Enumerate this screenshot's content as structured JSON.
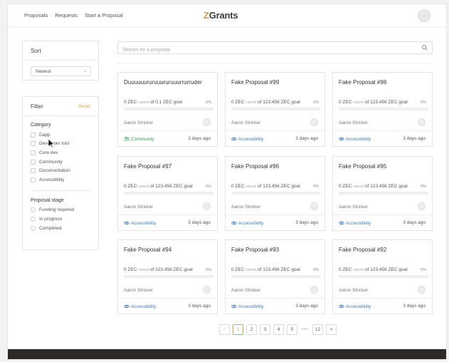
{
  "nav": {
    "links": [
      "Proposals",
      "Requests",
      "Start a Proposal"
    ]
  },
  "brand": {
    "prefix": "Z",
    "name": "Grants",
    "accent": "#c8a052"
  },
  "sort": {
    "heading": "Sort",
    "selected": "Newest"
  },
  "filter": {
    "heading": "Filter",
    "reset": "Reset",
    "category_title": "Category",
    "categories": [
      "Dapp",
      "Developer tool",
      "Core dev",
      "Community",
      "Documentation",
      "Accessibility"
    ],
    "stage_title": "Proposal stage",
    "stages": [
      "Funding required",
      "In progress",
      "Completed"
    ]
  },
  "search": {
    "placeholder": "Search for a proposal",
    "value": ""
  },
  "proposals": [
    {
      "title": "Duuuuuururuuururuuurrurruder",
      "raised": "0 ZEC",
      "raised_label": "raised",
      "goal": "of 0.1 ZEC goal",
      "percent": "0%",
      "progress": 0,
      "author": "Aaron Stricker",
      "category": "Community",
      "category_icon": "community-icon",
      "time": "3 days ago"
    },
    {
      "title": "Fake Proposal #99",
      "raised": "0 ZEC",
      "raised_label": "raised",
      "goal": "of 123.456 ZEC goal",
      "percent": "0%",
      "progress": 0,
      "author": "Aaron Stricker",
      "category": "Accessibility",
      "category_icon": "eye-icon",
      "time": "3 days ago"
    },
    {
      "title": "Fake Proposal #98",
      "raised": "0 ZEC",
      "raised_label": "raised",
      "goal": "of 123.456 ZEC goal",
      "percent": "0%",
      "progress": 0,
      "author": "Aaron Stricker",
      "category": "Accessibility",
      "category_icon": "eye-icon",
      "time": "3 days ago"
    },
    {
      "title": "Fake Proposal #97",
      "raised": "0 ZEC",
      "raised_label": "raised",
      "goal": "of 123.456 ZEC goal",
      "percent": "0%",
      "progress": 0,
      "author": "Aaron Stricker",
      "category": "Accessibility",
      "category_icon": "eye-icon",
      "time": "3 days ago"
    },
    {
      "title": "Fake Proposal #96",
      "raised": "0 ZEC",
      "raised_label": "raised",
      "goal": "of 123.456 ZEC goal",
      "percent": "0%",
      "progress": 0,
      "author": "Aaron Stricker",
      "category": "Accessibility",
      "category_icon": "eye-icon",
      "time": "3 days ago"
    },
    {
      "title": "Fake Proposal #95",
      "raised": "0 ZEC",
      "raised_label": "raised",
      "goal": "of 123.456 ZEC goal",
      "percent": "0%",
      "progress": 0,
      "author": "Aaron Stricker",
      "category": "Accessibility",
      "category_icon": "eye-icon",
      "time": "3 days ago"
    },
    {
      "title": "Fake Proposal #94",
      "raised": "0 ZEC",
      "raised_label": "raised",
      "goal": "of 123.456 ZEC goal",
      "percent": "0%",
      "progress": 0,
      "author": "Aaron Stricker",
      "category": "Accessibility",
      "category_icon": "eye-icon",
      "time": "3 days ago"
    },
    {
      "title": "Fake Proposal #93",
      "raised": "0 ZEC",
      "raised_label": "raised",
      "goal": "of 123.456 ZEC goal",
      "percent": "0%",
      "progress": 0,
      "author": "Aaron Stricker",
      "category": "Accessibility",
      "category_icon": "eye-icon",
      "time": "3 days ago"
    },
    {
      "title": "Fake Proposal #92",
      "raised": "0 ZEC",
      "raised_label": "raised",
      "goal": "of 123.456 ZEC goal",
      "percent": "0%",
      "progress": 0,
      "author": "Aaron Stricker",
      "category": "Accessibility",
      "category_icon": "eye-icon",
      "time": "3 days ago"
    }
  ],
  "pagination": {
    "prev": "<",
    "pages": [
      "1",
      "2",
      "3",
      "4",
      "5"
    ],
    "ellipsis": "•••",
    "last": "12",
    "next": ">",
    "current": "1"
  },
  "colors": {
    "accent": "#e3a34a",
    "community": "#3a9c5a",
    "accessibility": "#3d7ab8",
    "footer": "#2e2a27"
  }
}
